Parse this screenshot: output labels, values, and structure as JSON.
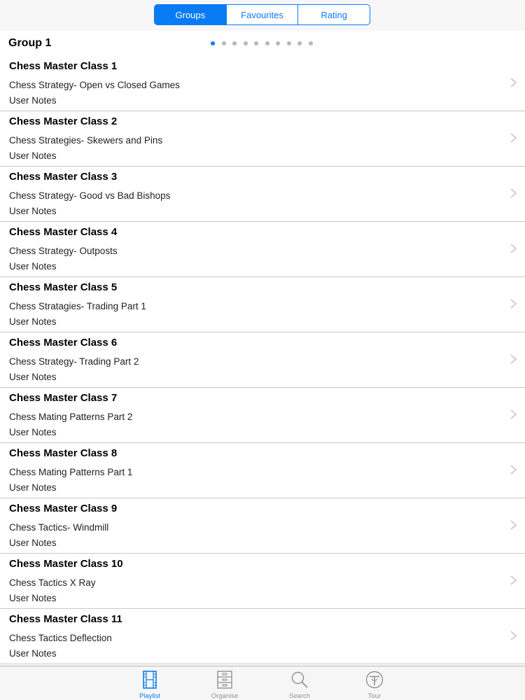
{
  "segments": [
    {
      "label": "Groups",
      "active": true
    },
    {
      "label": "Favourites",
      "active": false
    },
    {
      "label": "Rating",
      "active": false
    }
  ],
  "group": {
    "title": "Group 1",
    "page_count": 10,
    "current_page": 1
  },
  "rows": [
    {
      "title": "Chess Master Class 1",
      "subtitle": "Chess Strategy- Open vs Closed Games",
      "notes": "User Notes"
    },
    {
      "title": "Chess Master Class 2",
      "subtitle": "Chess Strategies- Skewers and Pins",
      "notes": "User Notes"
    },
    {
      "title": "Chess Master Class 3",
      "subtitle": "Chess Strategy- Good vs Bad Bishops",
      "notes": "User Notes"
    },
    {
      "title": "Chess Master Class 4",
      "subtitle": "Chess Strategy- Outposts",
      "notes": "User Notes"
    },
    {
      "title": "Chess Master Class 5",
      "subtitle": "Chess Stratagies- Trading Part 1",
      "notes": "User Notes"
    },
    {
      "title": "Chess Master Class 6",
      "subtitle": "Chess Strategy- Trading Part 2",
      "notes": "User Notes"
    },
    {
      "title": "Chess Master Class 7",
      "subtitle": "Chess Mating Patterns Part 2",
      "notes": "User Notes"
    },
    {
      "title": "Chess Master Class 8",
      "subtitle": "Chess Mating Patterns Part 1",
      "notes": "User Notes"
    },
    {
      "title": "Chess Master Class 9",
      "subtitle": "Chess Tactics- Windmill",
      "notes": "User Notes"
    },
    {
      "title": "Chess Master Class 10",
      "subtitle": "Chess Tactics X Ray",
      "notes": "User Notes"
    },
    {
      "title": "Chess Master Class 11",
      "subtitle": "Chess Tactics Deflection",
      "notes": "User Notes"
    }
  ],
  "tabs": [
    {
      "label": "Playlist",
      "icon": "film-icon",
      "active": true
    },
    {
      "label": "Organise",
      "icon": "cabinet-icon",
      "active": false
    },
    {
      "label": "Search",
      "icon": "search-icon",
      "active": false
    },
    {
      "label": "Tour",
      "icon": "tour-icon",
      "active": false
    }
  ],
  "colors": {
    "accent": "#0a7cf3",
    "inactive": "#929292",
    "separator": "#c8c7cc"
  }
}
